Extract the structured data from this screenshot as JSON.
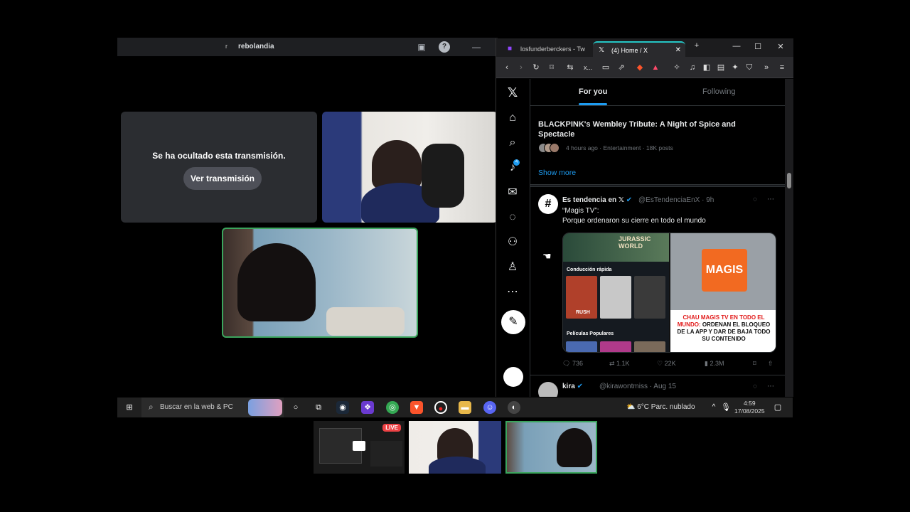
{
  "call": {
    "title": "rebolandia",
    "avatar_letter": "r",
    "hidden_stream": {
      "message": "Se ha ocultado esta transmisión.",
      "button_label": "Ver transmisión"
    },
    "live_badge": "LIVE"
  },
  "browser": {
    "tabs": [
      {
        "label": "losfunderberckers - Tw",
        "icon": "twitch-icon"
      },
      {
        "label": "(4) Home / X",
        "icon": "x-logo-icon"
      }
    ],
    "address_short": "x..."
  },
  "x": {
    "tabs": {
      "for_you": "For you",
      "following": "Following"
    },
    "notification_count": "4",
    "trend": {
      "title": "BLACKPINK's Wembley Tribute: A Night of Spice and Spectacle",
      "meta": "4 hours ago · Entertainment · 18K posts",
      "show_more": "Show more"
    },
    "tweet": {
      "avatar_glyph": "#",
      "name": "Es tendencia en 𝕏",
      "handle": "@EsTendenciaEnX · 9h",
      "line1": "“Magis TV”:",
      "line2": "Porque ordenaron su cierre en todo el mundo",
      "media": {
        "left_title": "JURASSIC WORLD",
        "left_section1": "Conducción rápida",
        "left_section2": "Películas Populares",
        "left_poster_caption": "RUSH",
        "right_logo": "MAGIS",
        "right_caption_red": "CHAU MAGIS TV EN TODO EL MUNDO:",
        "right_caption_dark": "ORDENAN EL BLOQUEO DE LA APP Y DAR DE BAJA TODO SU CONTENIDO"
      },
      "replies": "736",
      "reposts": "1.1K",
      "likes": "22K",
      "views": "2.3M"
    },
    "tweet2": {
      "name": "kira",
      "handle": "@kirawontmiss · Aug 15"
    }
  },
  "taskbar": {
    "search_placeholder": "Buscar en la web & PC",
    "weather": "6°C  Parc. nublado",
    "time": "4:59",
    "date": "17/08/2025"
  }
}
